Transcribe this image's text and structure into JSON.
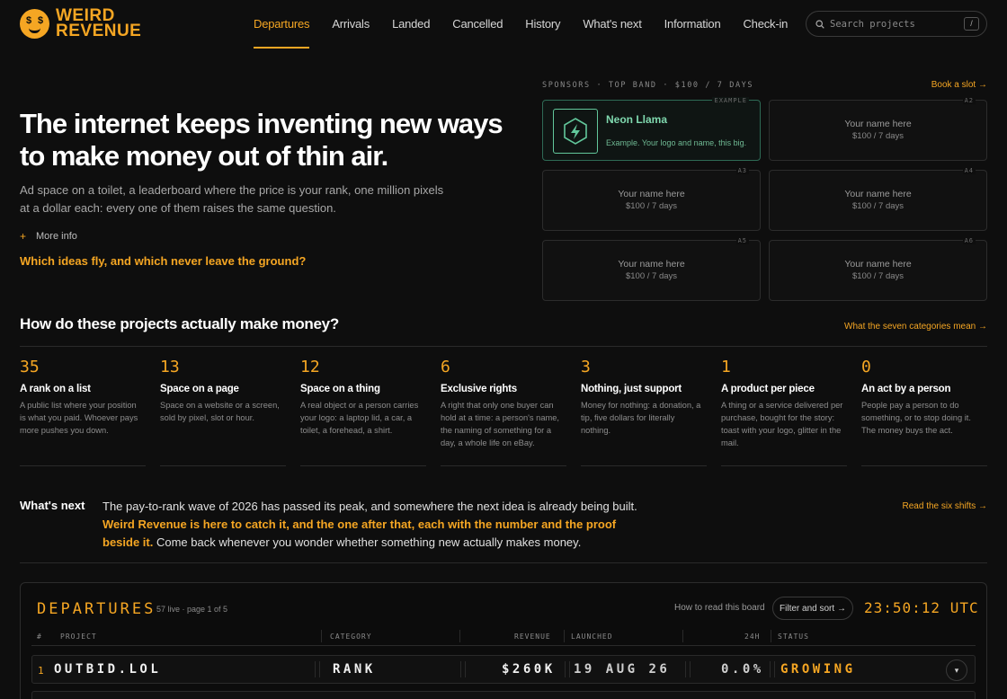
{
  "brand": {
    "line1": "WEIRD",
    "line2": "REVENUE",
    "logo_eyes": "$"
  },
  "nav": {
    "items": [
      {
        "label": "Departures",
        "active": true
      },
      {
        "label": "Arrivals"
      },
      {
        "label": "Landed"
      },
      {
        "label": "Cancelled"
      },
      {
        "label": "History"
      },
      {
        "label": "What's next"
      },
      {
        "label": "Information"
      },
      {
        "label": "Check-in"
      }
    ],
    "search_placeholder": "Search projects",
    "search_shortcut": "/"
  },
  "hero": {
    "title": "The internet keeps inventing new ways to make money out of thin air.",
    "description": "Ad space on a toilet, a leaderboard where the price is your rank, one million pixels at a dollar each: every one of them raises the same question.",
    "more_info_icon": "+",
    "more_info": "More info",
    "question": "Which ideas fly, and which never leave the ground?"
  },
  "sponsors": {
    "label": "SPONSORS · TOP BAND · $100 / 7 DAYS",
    "book_link": "Book a slot →",
    "example": {
      "tag": "EXAMPLE",
      "name": "Neon Llama",
      "desc": "Example. Your logo and name, this big.",
      "icon": "bolt-hexagon-icon"
    },
    "slots": [
      {
        "tag": "A2",
        "name": "Your name here",
        "price": "$100 / 7 days"
      },
      {
        "tag": "A3",
        "name": "Your name here",
        "price": "$100 / 7 days"
      },
      {
        "tag": "A4",
        "name": "Your name here",
        "price": "$100 / 7 days"
      },
      {
        "tag": "A5",
        "name": "Your name here",
        "price": "$100 / 7 days"
      },
      {
        "tag": "A6",
        "name": "Your name here",
        "price": "$100 / 7 days"
      }
    ]
  },
  "categories": {
    "title": "How do these projects actually make money?",
    "link": "What the seven categories mean →",
    "items": [
      {
        "count": "35",
        "name": "A rank on a list",
        "desc": "A public list where your position is what you paid. Whoever pays more pushes you down."
      },
      {
        "count": "13",
        "name": "Space on a page",
        "desc": "Space on a website or a screen, sold by pixel, slot or hour."
      },
      {
        "count": "12",
        "name": "Space on a thing",
        "desc": "A real object or a person carries your logo: a laptop lid, a car, a toilet, a forehead, a shirt."
      },
      {
        "count": "6",
        "name": "Exclusive rights",
        "desc": "A right that only one buyer can hold at a time: a person's name, the naming of something for a day, a whole life on eBay."
      },
      {
        "count": "3",
        "name": "Nothing, just support",
        "desc": "Money for nothing: a donation, a tip, five dollars for literally nothing."
      },
      {
        "count": "1",
        "name": "A product per piece",
        "desc": "A thing or a service delivered per purchase, bought for the story: toast with your logo, glitter in the mail."
      },
      {
        "count": "0",
        "name": "An act by a person",
        "desc": "People pay a person to do something, or to stop doing it. The money buys the act."
      }
    ]
  },
  "whats_next": {
    "label": "What's next",
    "text_a": "The pay-to-rank wave of 2026 has passed its peak, and somewhere the next idea is already being built.",
    "text_highlight": "Weird Revenue is here to catch it, and the one after that, each with the number and the proof beside it.",
    "text_b": "Come back whenever you wonder whether something new actually makes money.",
    "link": "Read the six shifts →"
  },
  "board": {
    "title": "DEPARTURES",
    "meta": "57 live · page 1 of 5",
    "how_link": "How to read this board",
    "filter_button": "Filter and sort →",
    "clock": "23:50:12 UTC",
    "columns": {
      "rank": "#",
      "project": "PROJECT",
      "category": "CATEGORY",
      "revenue": "REVENUE",
      "launched": "LAUNCHED",
      "change": "24H",
      "status": "STATUS"
    },
    "rows": [
      {
        "rank": "1",
        "project": "OUTBID.LOL",
        "category": "RANK",
        "revenue": "$260K",
        "launched": "19 AUG 26",
        "change": "0.0%",
        "status": "GROWING",
        "expand_icon": "▾"
      }
    ]
  },
  "colors": {
    "accent": "#f5a623",
    "background": "#0e0e0e",
    "sponsor_green": "#62c79b"
  }
}
